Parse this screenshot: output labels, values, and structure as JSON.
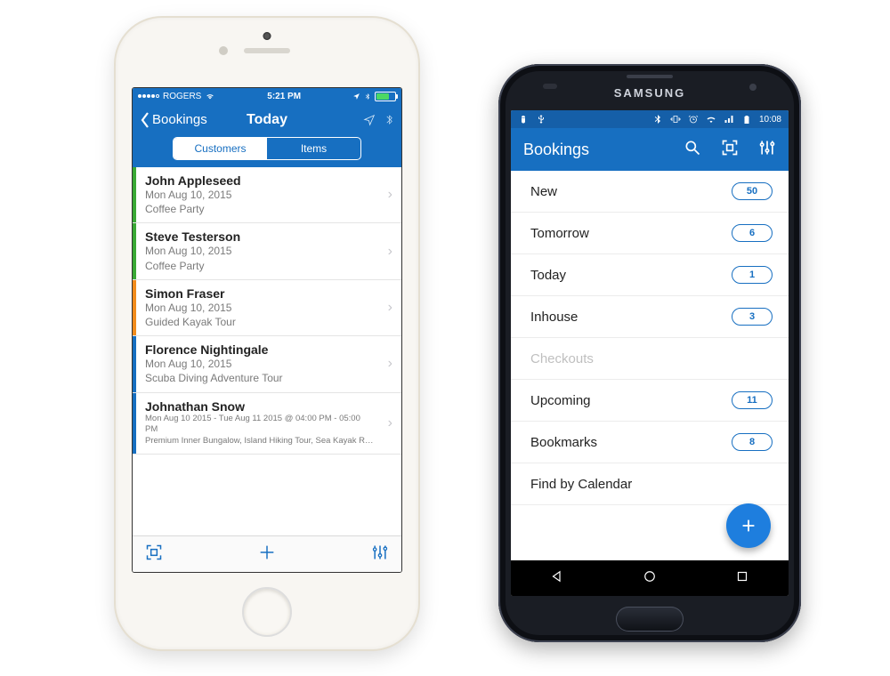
{
  "ios": {
    "status": {
      "carrier": "ROGERS",
      "time": "5:21 PM"
    },
    "nav": {
      "back_label": "Bookings",
      "title": "Today",
      "segments": {
        "customers": "Customers",
        "items": "Items"
      }
    },
    "rows": [
      {
        "name": "John Appleseed",
        "date": "Mon Aug 10, 2015",
        "sub": "Coffee Party",
        "color": "#3aa935"
      },
      {
        "name": "Steve Testerson",
        "date": "Mon Aug 10, 2015",
        "sub": "Coffee Party",
        "color": "#3aa935"
      },
      {
        "name": "Simon Fraser",
        "date": "Mon Aug 10, 2015",
        "sub": "Guided Kayak Tour",
        "color": "#f28c1c"
      },
      {
        "name": "Florence Nightingale",
        "date": "Mon Aug 10, 2015",
        "sub": "Scuba Diving Adventure Tour",
        "color": "#176fc1"
      },
      {
        "name": "Johnathan Snow",
        "date": "Mon Aug 10 2015 - Tue Aug 11 2015 @ 04:00 PM - 05:00 PM",
        "sub": "Premium Inner Bungalow, Island Hiking Tour, Sea Kayak Rental",
        "color": "#176fc1",
        "small": true
      }
    ]
  },
  "android": {
    "brand": "SAMSUNG",
    "status": {
      "time": "10:08"
    },
    "appbar": {
      "title": "Bookings"
    },
    "rows": [
      {
        "label": "New",
        "count": "50"
      },
      {
        "label": "Tomorrow",
        "count": "6"
      },
      {
        "label": "Today",
        "count": "1"
      },
      {
        "label": "Inhouse",
        "count": "3"
      },
      {
        "label": "Checkouts",
        "count": null,
        "disabled": true
      },
      {
        "label": "Upcoming",
        "count": "11"
      },
      {
        "label": "Bookmarks",
        "count": "8"
      },
      {
        "label": "Find by Calendar",
        "count": null
      }
    ]
  }
}
